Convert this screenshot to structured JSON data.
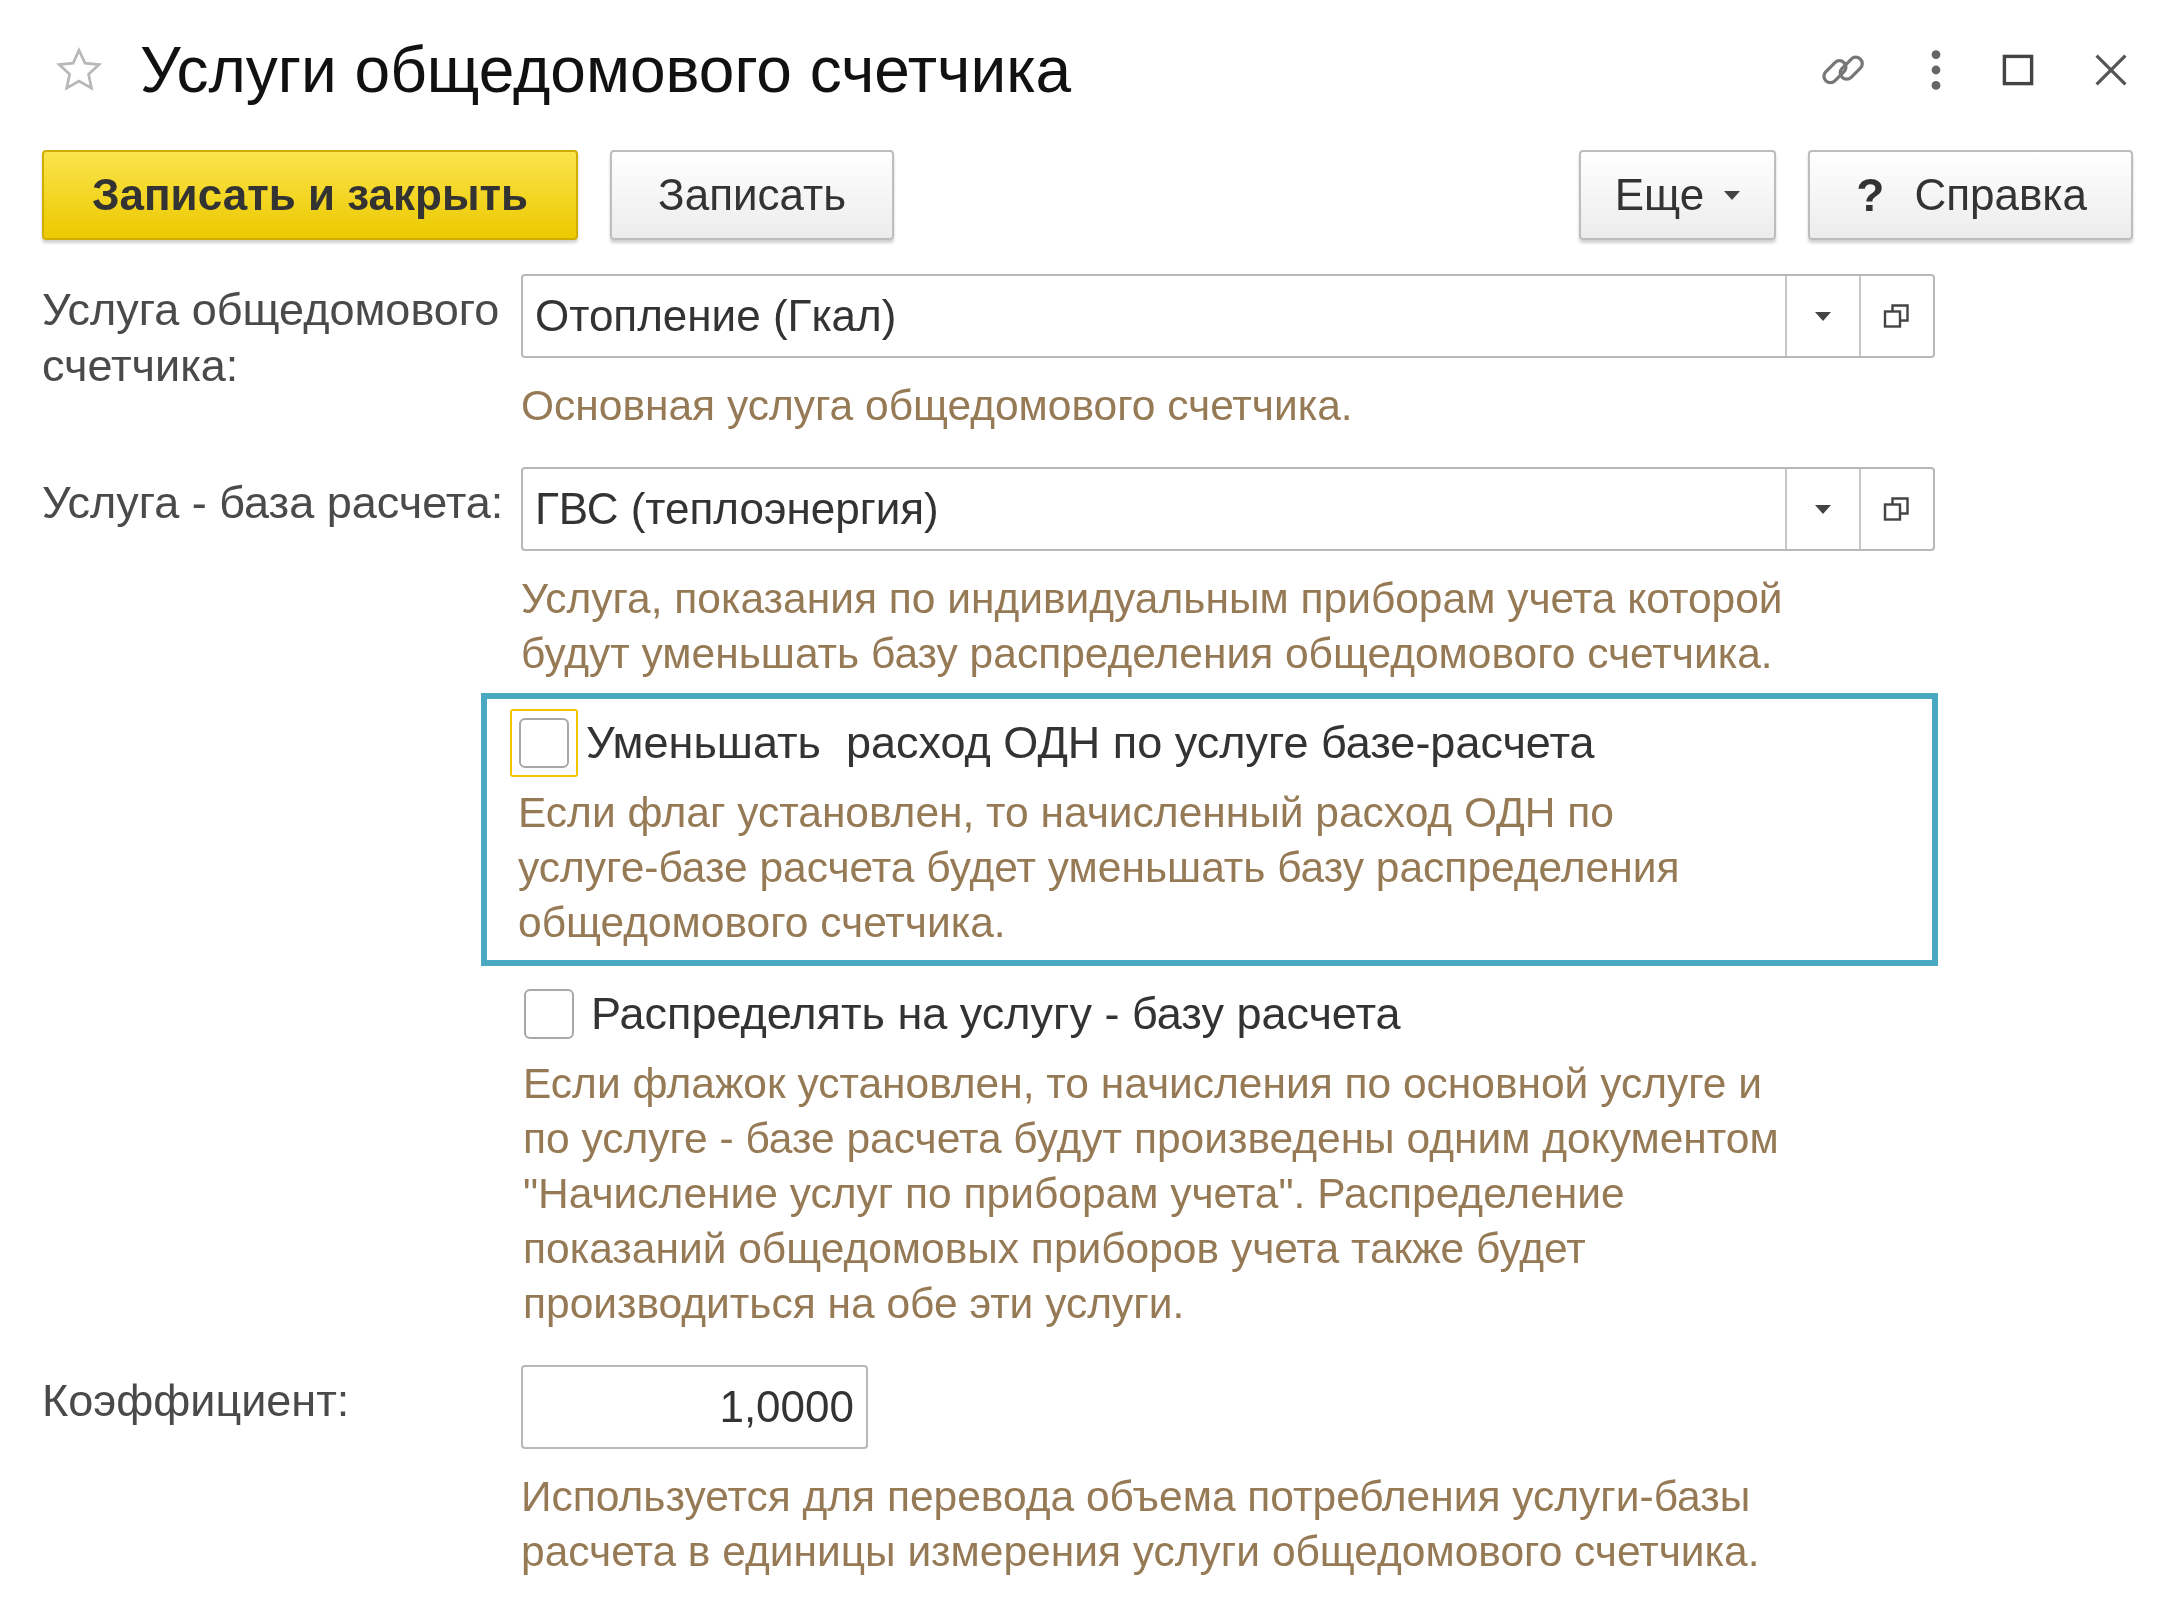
{
  "window": {
    "title": "Услуги общедомового счетчика",
    "favorite": false
  },
  "toolbar": [
    {
      "kind": "primary",
      "label": "Записать и закрыть"
    },
    {
      "kind": "default",
      "label": "Записать"
    },
    {
      "kind": "menu",
      "label": "Еще"
    },
    {
      "kind": "help",
      "icon_text": "?",
      "label": "Справка"
    }
  ],
  "form": [
    {
      "kind": "select",
      "label": "Услуга общедомового счетчика:",
      "value": "Отопление (Гкал)",
      "hint": [
        "Основная услуга общедомового счетчика."
      ]
    },
    {
      "kind": "select",
      "label": "Услуга - база расчета:",
      "value": "ГВС (теплоэнергия)",
      "hint": [
        "Услуга, показания по индивидуальным приборам учета которой",
        "будут уменьшать базу распределения общедомового счетчика."
      ]
    },
    {
      "kind": "checkbox",
      "label": "Уменьшать  расход ОДН по услуге базе-расчета",
      "checked": false,
      "focused": true,
      "highlighted": true,
      "hint": [
        "Если флаг установлен, то начисленный расход ОДН по",
        "услуге-базе расчета будет уменьшать базу распределения",
        "общедомового счетчика."
      ]
    },
    {
      "kind": "checkbox",
      "label": "Распределять на услугу - базу расчета",
      "checked": false,
      "focused": false,
      "highlighted": false,
      "hint": [
        "Если флажок установлен, то начисления по основной услуге и",
        "по услуге - базе расчета будут произведены одним документом",
        "\"Начисление услуг по приборам учета\". Распределение",
        "показаний общедомовых приборов учета также будет",
        "производиться на обе эти услуги."
      ]
    },
    {
      "kind": "number",
      "label": "Коэффициент:",
      "value": "1,0000",
      "hint": [
        "Используется для перевода объема потребления услуги-базы",
        "расчета в единицы измерения услуги общедомового счетчика."
      ]
    }
  ]
}
